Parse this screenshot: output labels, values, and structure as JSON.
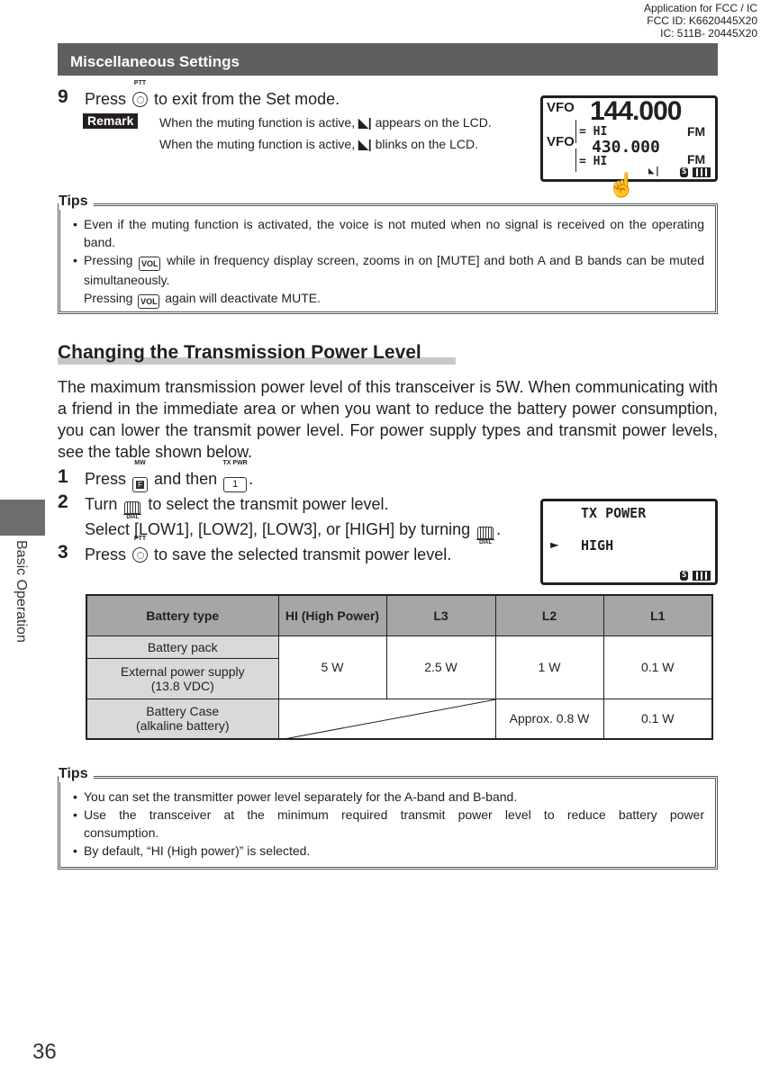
{
  "fcc_header": [
    "Application for FCC / IC",
    "FCC ID: K6620445X20",
    "IC: 511B- 20445X20"
  ],
  "section_header": "Miscellaneous Settings",
  "side_label": "Basic Operation",
  "page_number": "36",
  "step9": {
    "number": "9",
    "pre": "Press",
    "icon_label": "PTT",
    "post": "to exit from the Set mode.",
    "remark_label": "Remark",
    "remark_lines": [
      {
        "pre": "When the muting function is active,",
        "post": "appears on the LCD."
      },
      {
        "pre": "When the muting function is active,",
        "post": "blinks on the LCD."
      }
    ]
  },
  "lcd1": {
    "vfo_a": "VFO",
    "freq_a": "144.000",
    "power_a": "= HI",
    "mode_a": "FM",
    "vfo_b": "VFO",
    "freq_b": "430.000",
    "power_b": "= HI",
    "mode_b": "FM",
    "s_badge": "S"
  },
  "tips1": {
    "label": "Tips",
    "items": [
      {
        "text": "Even if the muting function is activated, the voice is not muted when no signal is received on the operating band."
      },
      {
        "pre": "Pressing",
        "icon": "VOL",
        "post": "while in frequency display screen, zooms in on [MUTE] and both A and B bands can be muted simultaneously.",
        "pre2": "Pressing",
        "post2": "again will deactivate MUTE."
      }
    ]
  },
  "section2": {
    "title": "Changing the Transmission Power Level",
    "paragraph": "The maximum transmission power level of this transceiver is 5W. When communicating with a friend in the immediate area or when you want to reduce the battery power consumption, you can lower the transmit power level. For power supply types and transmit power levels, see the table shown below.",
    "steps": [
      {
        "number": "1",
        "pre": "Press",
        "icon1_top": "MW",
        "icon1": "F",
        "mid": "and then",
        "icon2_top": "TX PWR",
        "icon2": "1",
        "post": "."
      },
      {
        "number": "2",
        "pre": "Turn",
        "icon_label": "DIAL",
        "post": "to select the transmit power level.",
        "line2": "Select [LOW1], [LOW2], [LOW3], or [HIGH] by turning",
        "line2_post": "."
      },
      {
        "number": "3",
        "pre": "Press",
        "icon_label": "PTT",
        "post": "to save the selected transmit power level."
      }
    ]
  },
  "lcd2": {
    "title": "TX POWER",
    "arrow": "►",
    "value": "HIGH",
    "s_badge": "S"
  },
  "table": {
    "headers": [
      "Battery type",
      "HI (High Power)",
      "L3",
      "L2",
      "L1"
    ],
    "rows": [
      {
        "type": "Battery pack"
      },
      {
        "type": "External power supply (13.8 VDC)"
      },
      {
        "type": "Battery Case (alkaline battery)",
        "l2": "Approx. 0.8 W",
        "l1": "0.1 W"
      }
    ],
    "shared": {
      "hi": "5 W",
      "l3": "2.5 W",
      "l2": "1 W",
      "l1": "0.1 W"
    }
  },
  "tips2": {
    "label": "Tips",
    "items": [
      "You can set the transmitter power level separately for the A-band and B-band.",
      "Use the transceiver at the minimum required transmit power level to reduce battery power consumption.",
      "By default, “HI (High power)” is selected."
    ]
  }
}
